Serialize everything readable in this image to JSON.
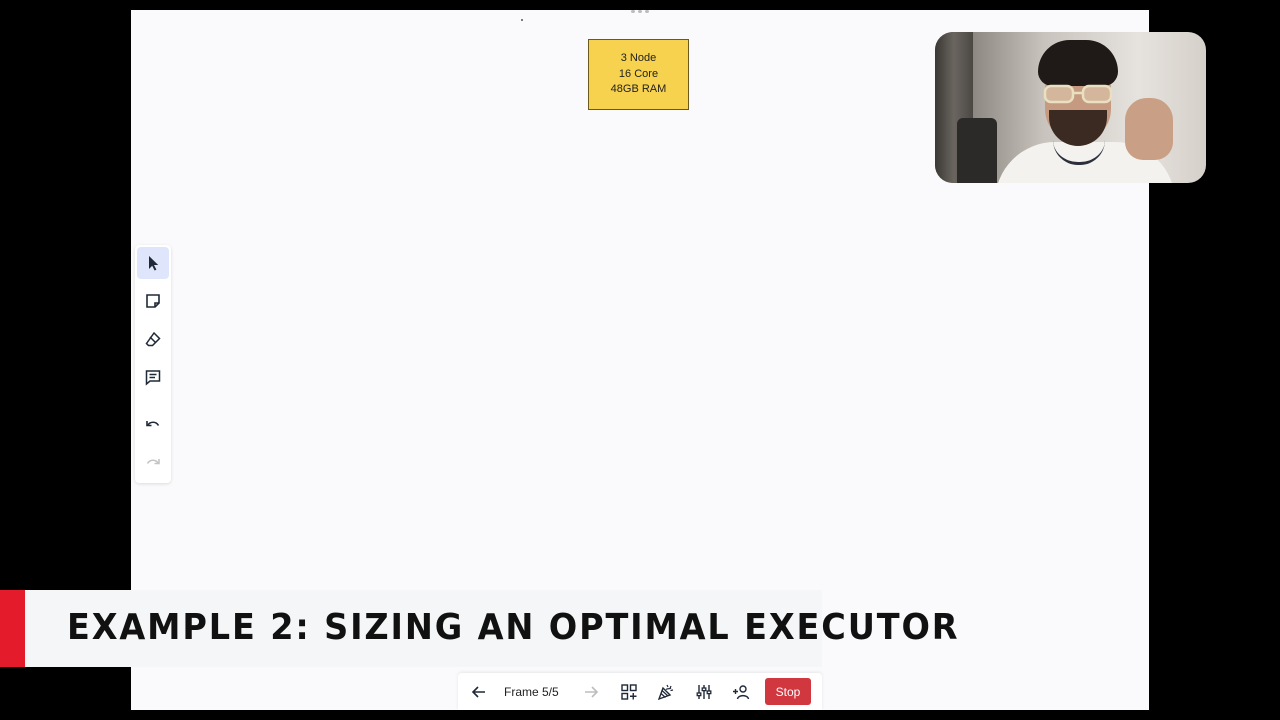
{
  "canvas": {
    "sticky_note": {
      "line1": "3 Node",
      "line2": "16 Core",
      "line3": "48GB RAM",
      "color": "#f7d24f"
    }
  },
  "left_toolbar": {
    "tools": [
      {
        "icon": "cursor-icon",
        "active": true
      },
      {
        "icon": "sticky-note-icon",
        "active": false
      },
      {
        "icon": "eraser-icon",
        "active": false
      },
      {
        "icon": "comment-icon",
        "active": false
      },
      {
        "icon": "undo-icon",
        "active": false
      },
      {
        "icon": "redo-icon",
        "active": false,
        "disabled": true
      }
    ],
    "active_color": "#dfe6fb"
  },
  "lower_third": {
    "title": "EXAMPLE 2: SIZING AN OPTIMAL EXECUTOR",
    "accent_color": "#e31b2a"
  },
  "bottom_bar": {
    "prev_icon": "arrow-left-icon",
    "frame_label": "Frame 5/5",
    "next_icon": "arrow-right-icon",
    "apps_icon": "apps-add-icon",
    "celebrate_icon": "party-popper-icon",
    "settings_icon": "sliders-icon",
    "invite_icon": "add-user-icon",
    "stop_label": "Stop",
    "stop_color": "#d0373f"
  },
  "webcam": {
    "shape": "rounded-rectangle"
  }
}
